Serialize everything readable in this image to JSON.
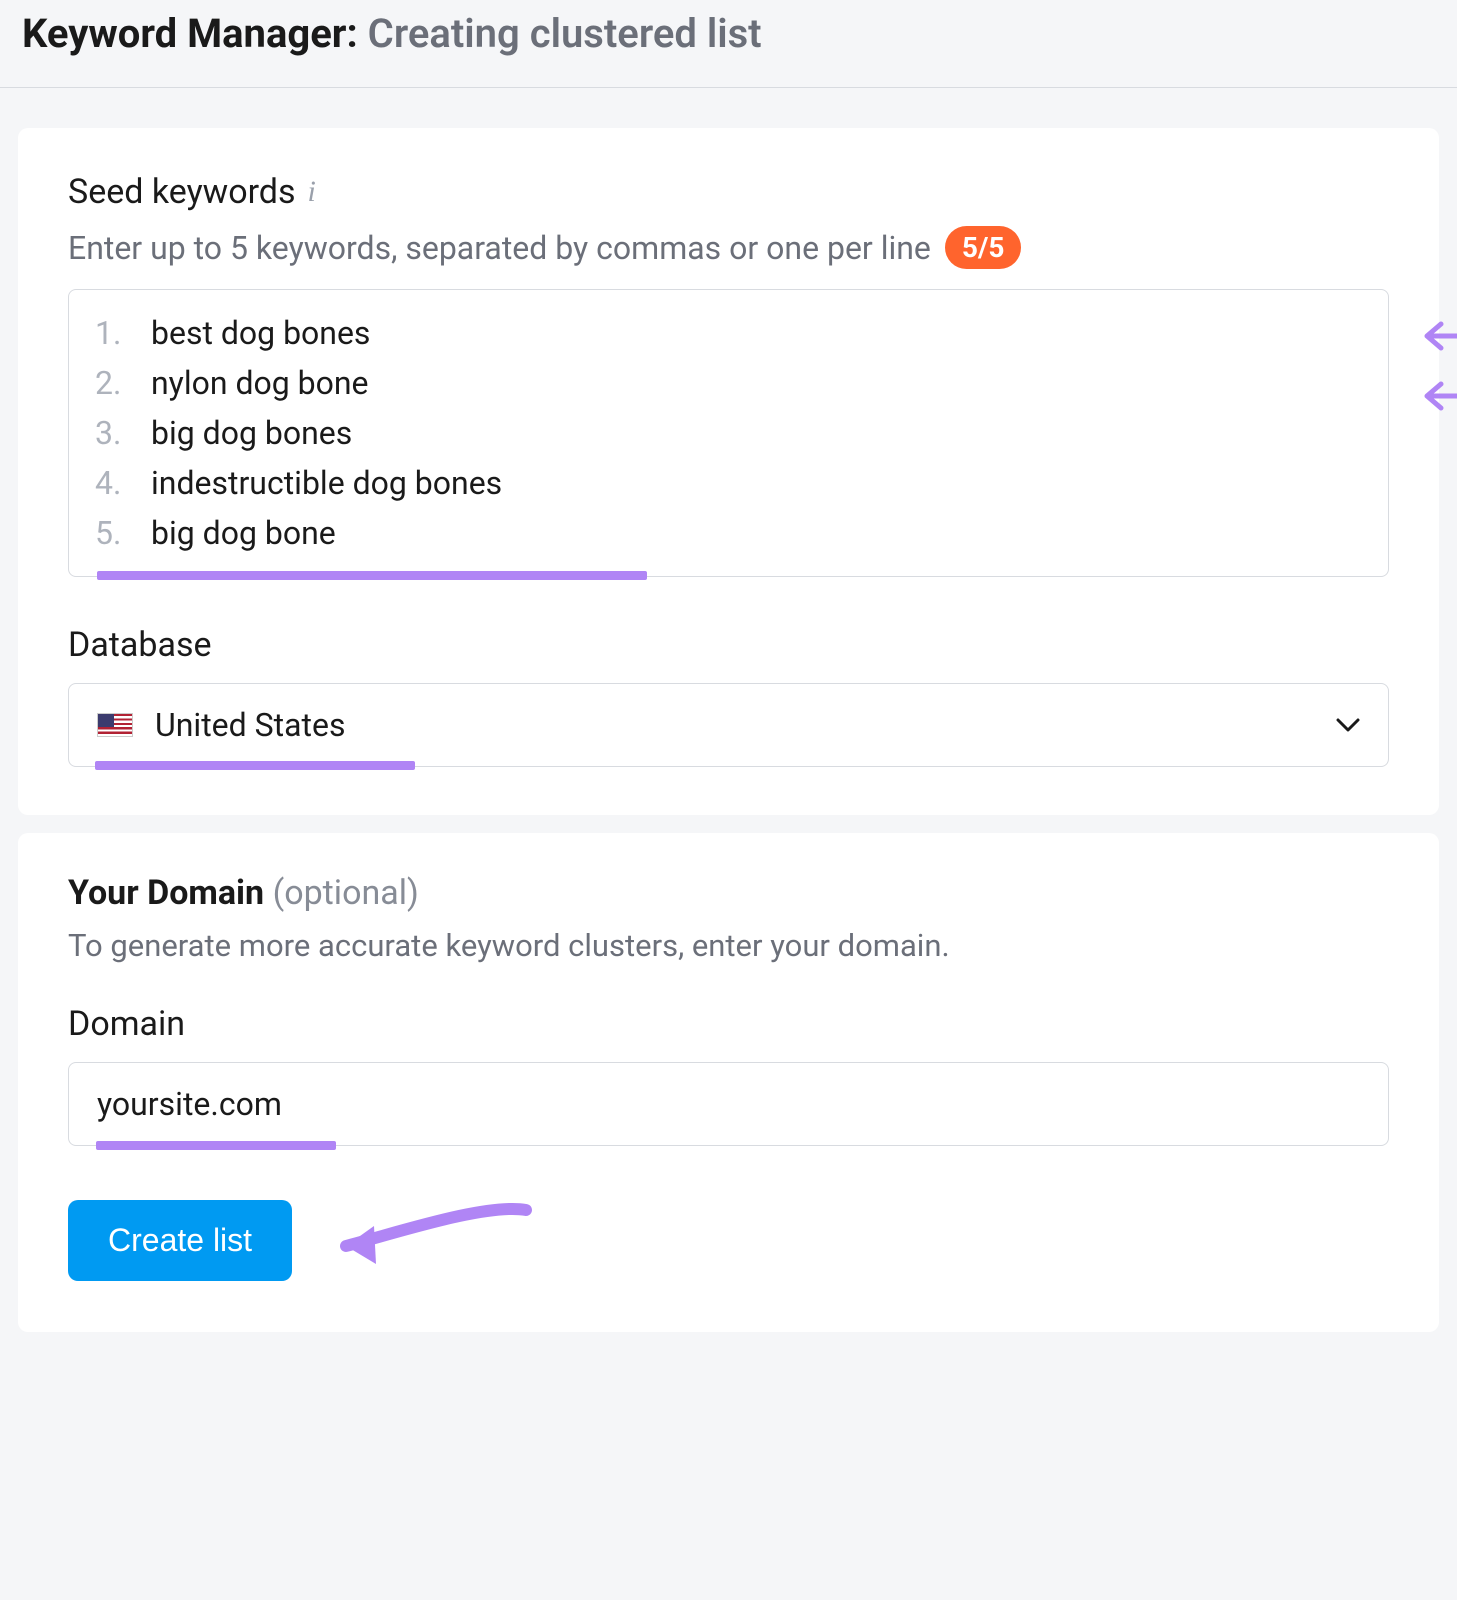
{
  "header": {
    "title": "Keyword Manager: ",
    "subtitle": "Creating clustered list"
  },
  "seed": {
    "label": "Seed keywords",
    "helper": "Enter up to 5 keywords, separated by commas or one per line",
    "counter": "5/5",
    "keywords": [
      "best dog bones",
      "nylon dog bone",
      "big dog bones",
      "indestructible dog bones",
      "big dog bone"
    ]
  },
  "database": {
    "label": "Database",
    "selected": "United States"
  },
  "domain": {
    "title": "Your Domain ",
    "optional": "(optional)",
    "description": "To generate more accurate keyword clusters, enter your domain.",
    "field_label": "Domain",
    "value": "yoursite.com"
  },
  "actions": {
    "create": "Create list"
  }
}
